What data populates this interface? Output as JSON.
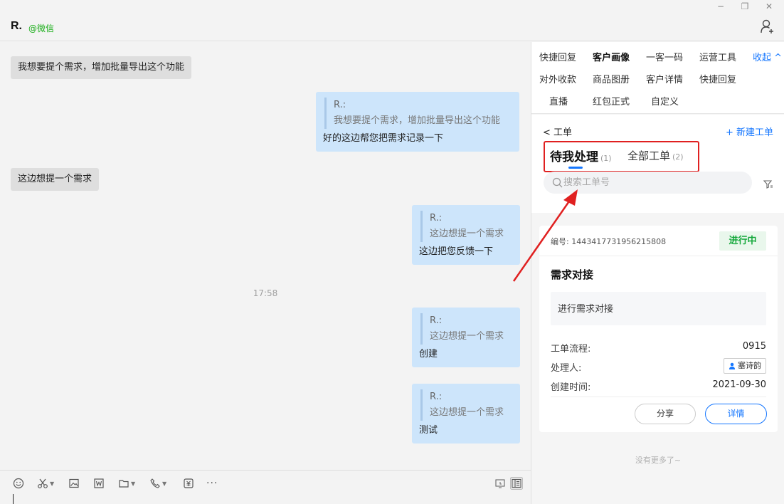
{
  "window": {
    "minimize": "−",
    "restore": "❐",
    "close": "✕"
  },
  "header": {
    "contact_name": "R.",
    "contact_tag": "@微信",
    "add_user_icon": "add-user-icon"
  },
  "chat": {
    "messages": [
      {
        "dir": "in",
        "text": "我想要提个需求，增加批量导出这个功能"
      },
      {
        "dir": "out",
        "quote_name": "R.:",
        "quote_text": "我想要提个需求，增加批量导出这个功能",
        "text": "好的这边帮您把需求记录一下"
      },
      {
        "dir": "in",
        "text": "这边想提一个需求"
      },
      {
        "dir": "out",
        "quote_name": "R.:",
        "quote_text": "这边想提一个需求",
        "text": "这边把您反馈一下"
      },
      {
        "dir": "out",
        "quote_name": "R.:",
        "quote_text": "这边想提一个需求",
        "text": "创建"
      },
      {
        "dir": "out",
        "quote_name": "R.:",
        "quote_text": "这边想提一个需求",
        "text": "测试"
      }
    ],
    "timestamp": "17:58"
  },
  "toolbar": {
    "icons": [
      "emoji-icon",
      "scissors-icon",
      "image-icon",
      "word-icon",
      "folder-icon",
      "phone-icon",
      "payment-icon",
      "more-icon"
    ],
    "more": "···"
  },
  "panel": {
    "tools": {
      "row1": [
        "快捷回复",
        "客户画像",
        "一客一码",
        "运营工具"
      ],
      "row2": [
        "对外收款",
        "商品图册",
        "客户详情",
        "快捷回复"
      ],
      "row3": [
        "直播",
        "红包正式",
        "自定义"
      ],
      "active": "客户画像",
      "collapse": "收起 ^"
    },
    "tickets": {
      "back": "< 工单",
      "new": "+ 新建工单",
      "tab_mine": "待我处理",
      "tab_mine_count": "(1)",
      "tab_all": "全部工单",
      "tab_all_count": "(2)",
      "search_placeholder": "搜索工单号"
    },
    "card": {
      "id_label": "编号: 1443417731956215808",
      "status": "进行中",
      "title": "需求对接",
      "desc": "进行需求对接",
      "flow_label": "工单流程:",
      "flow_value": "0915",
      "handler_label": "处理人:",
      "handler_value": "塞诗韵",
      "created_label": "创建时间:",
      "created_value": "2021-09-30",
      "share": "分享",
      "detail": "详情",
      "status_color": "#14a83b"
    },
    "no_more": "没有更多了~"
  },
  "colors": {
    "accent": "#1677ff",
    "annotation": "#e02020",
    "bubble_out": "#cde5fb",
    "bubble_in": "#dedede"
  }
}
